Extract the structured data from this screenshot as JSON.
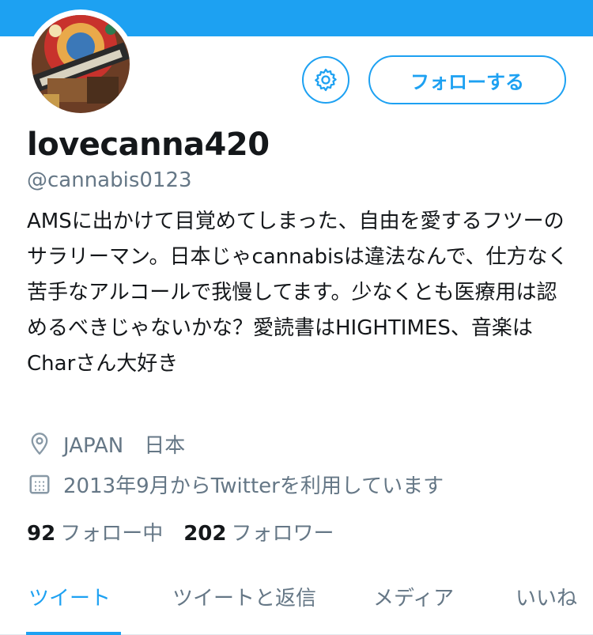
{
  "profile": {
    "display_name": "lovecanna420",
    "handle": "@cannabis0123",
    "bio": "AMSに出かけて目覚めてしまった、自由を愛するフツーのサラリーマン。日本じゃcannabisは違法なんで、仕方なく苦手なアルコールで我慢してます。少なくとも医療用は認めるべきじゃないかな？愛読書はHIGHTIMES、音楽はCharさん大好き",
    "location": "JAPAN　日本",
    "joined": "2013年9月からTwitterを利用しています",
    "following_count": "92",
    "following_label": "フォロー中",
    "followers_count": "202",
    "followers_label": "フォロワー"
  },
  "actions": {
    "follow_label": "フォローする",
    "settings_icon": "gear-icon"
  },
  "tabs": [
    {
      "label": "ツイート",
      "active": true
    },
    {
      "label": "ツイートと返信",
      "active": false
    },
    {
      "label": "メディア",
      "active": false
    },
    {
      "label": "いいね",
      "active": false
    }
  ],
  "icons": {
    "location": "location-pin-icon",
    "calendar": "calendar-icon"
  },
  "colors": {
    "accent": "#1da1f2",
    "text": "#14171a",
    "secondary": "#657786"
  }
}
